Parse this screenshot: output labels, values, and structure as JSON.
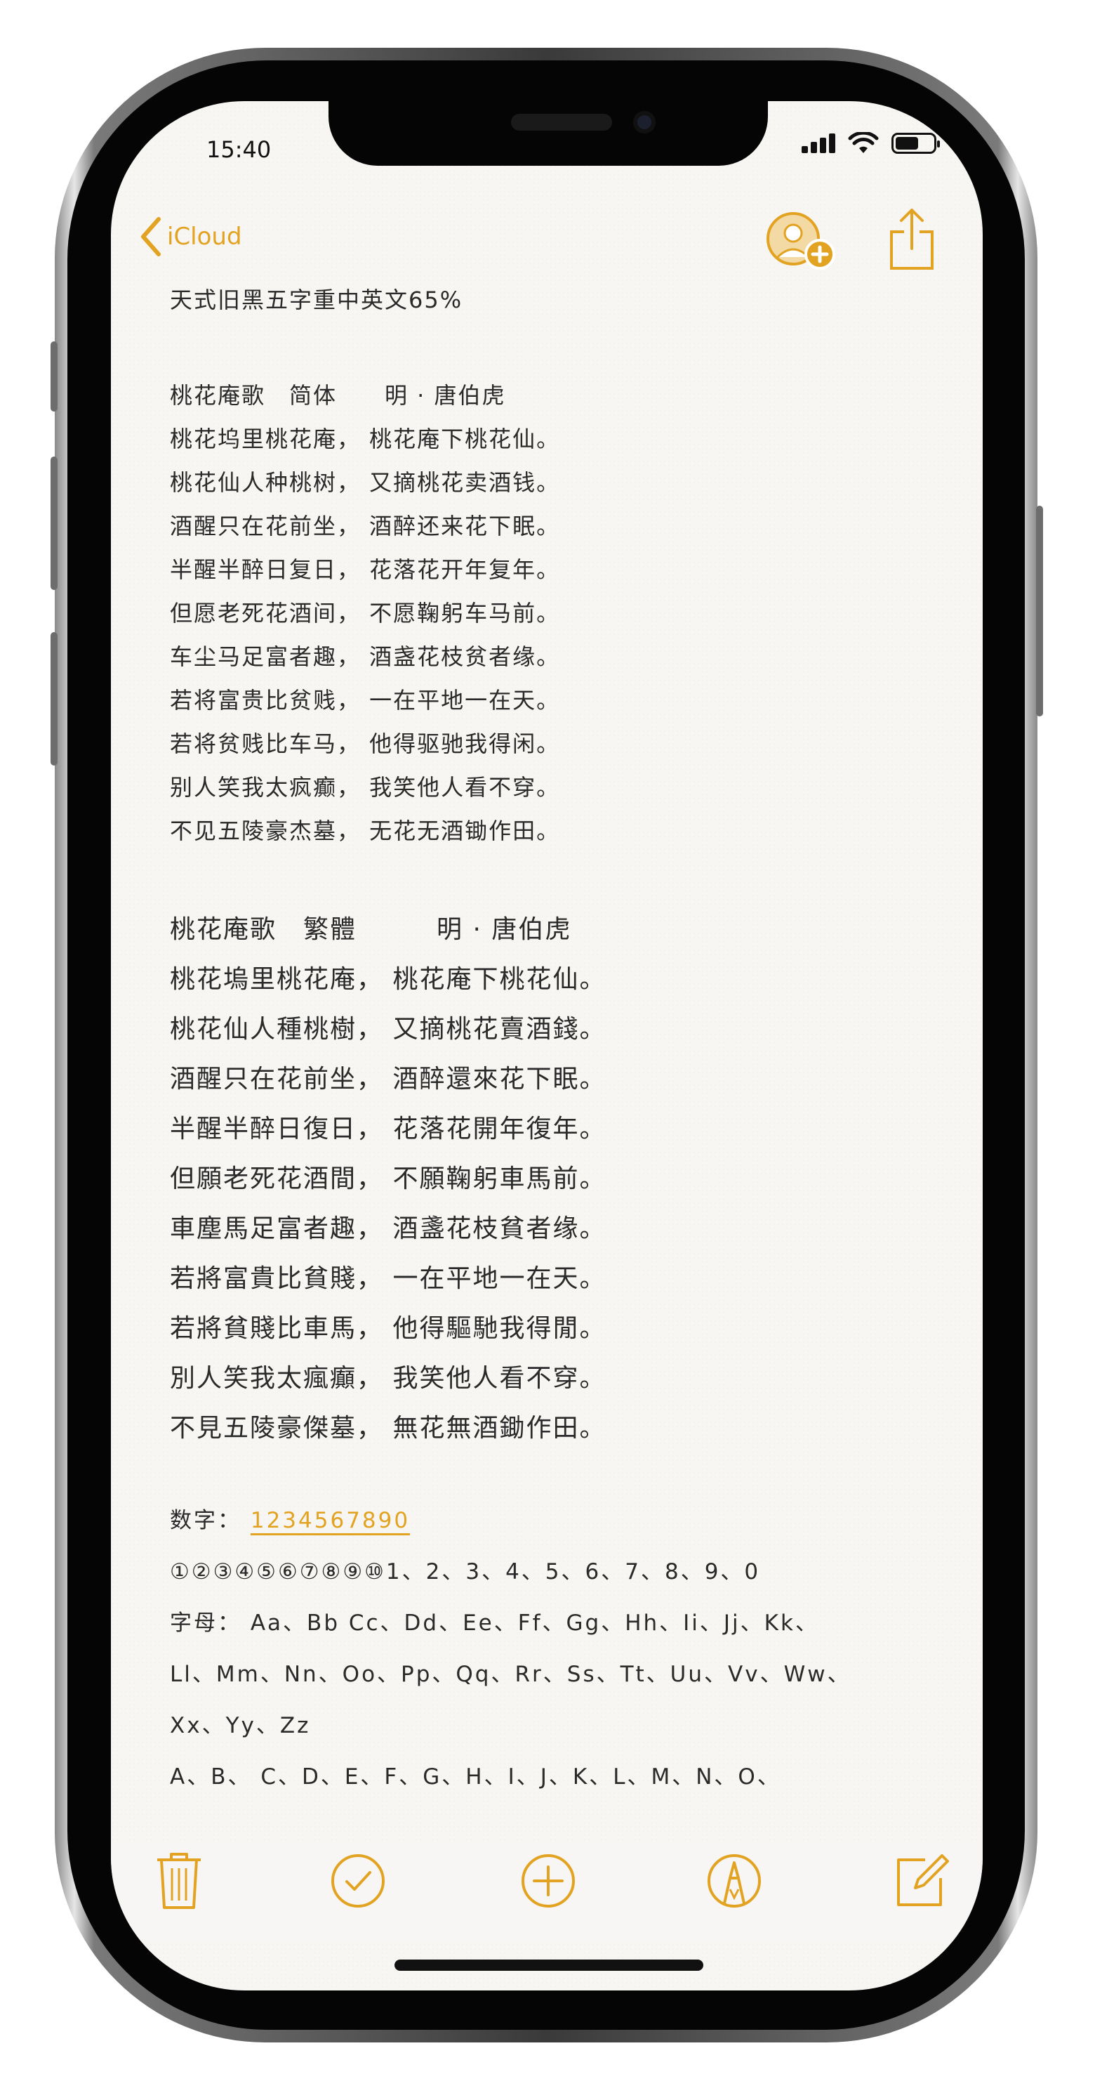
{
  "status_bar": {
    "time": "15:40"
  },
  "nav": {
    "back_label": "iCloud"
  },
  "note": {
    "heading": "天式旧黑五字重中英文65%",
    "poem_simplified": {
      "title": "桃花庵歌　简体　　明 · 唐伯虎",
      "lines": [
        "桃花坞里桃花庵， 桃花庵下桃花仙。",
        "桃花仙人种桃树， 又摘桃花卖酒钱。",
        "酒醒只在花前坐， 酒醉还来花下眠。",
        "半醒半醉日复日， 花落花开年复年。",
        "但愿老死花酒间， 不愿鞠躬车马前。",
        "车尘马足富者趣， 酒盏花枝贫者缘。",
        "若将富贵比贫贱， 一在平地一在天。",
        "若将贫贱比车马， 他得驱驰我得闲。",
        "别人笑我太疯癫， 我笑他人看不穿。",
        "不见五陵豪杰墓， 无花无酒锄作田。"
      ]
    },
    "poem_traditional": {
      "title": "桃花庵歌　繁體　　　明 · 唐伯虎",
      "lines": [
        "桃花塢里桃花庵， 桃花庵下桃花仙。",
        "桃花仙人種桃樹， 又摘桃花賣酒錢。",
        "酒醒只在花前坐， 酒醉還來花下眠。",
        "半醒半醉日復日， 花落花開年復年。",
        "但願老死花酒間， 不願鞠躬車馬前。",
        "車塵馬足富者趣， 酒盞花枝貧者缘。",
        "若將富貴比貧賤， 一在平地一在天。",
        "若將貧賤比車馬， 他得驅馳我得閒。",
        "別人笑我太瘋癲， 我笑他人看不穿。",
        "不見五陵豪傑墓， 無花無酒鋤作田。"
      ]
    },
    "numbers_label": "数字：",
    "numbers_link": "1234567890",
    "numbers_line": "①②③④⑤⑥⑦⑧⑨⑩1、2、3、4、5、6、7、8、9、0",
    "letters_line1": "字母： Aa、Bb Cc、Dd、Ee、Ff、Gg、Hh、Ii、Jj、Kk、",
    "letters_line2": "Ll、Mm、Nn、Oo、Pp、Qq、Rr、Ss、Tt、Uu、Vv、Ww、",
    "letters_line3": "Xx、Yy、Zz",
    "letters_line4": "A、B、 C、D、E、F、G、H、I、J、K、L、M、N、O、"
  },
  "toolbar": {
    "icons": [
      "trash-icon",
      "checklist-icon",
      "add-icon",
      "markup-icon",
      "compose-icon"
    ]
  },
  "colors": {
    "accent": "#e3a322",
    "text": "#2a2a2a",
    "paper": "#f7f6f3"
  }
}
